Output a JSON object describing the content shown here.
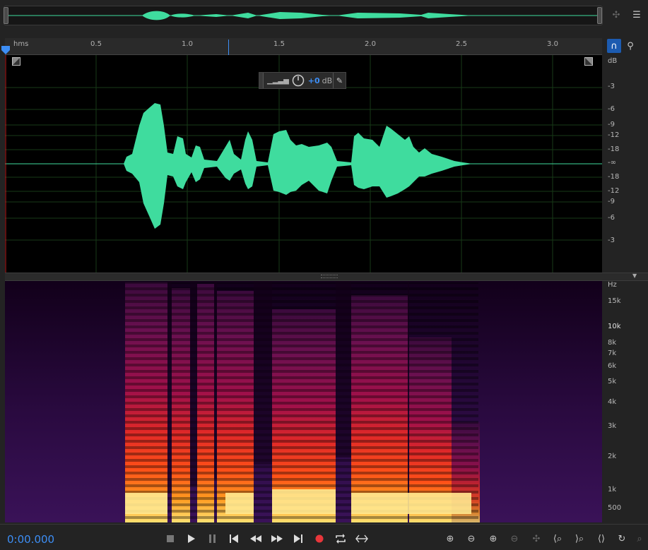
{
  "ruler": {
    "unit_label": "hms",
    "ticks": [
      "0.5",
      "1.0",
      "1.5",
      "2.0",
      "2.5",
      "3.0"
    ]
  },
  "db_scale": {
    "unit": "dB",
    "labels": [
      "-3",
      "-6",
      "-9",
      "-12",
      "-18",
      "-∞",
      "-18",
      "-12",
      "-9",
      "-6",
      "-3"
    ]
  },
  "hz_scale": {
    "unit": "Hz",
    "labels": [
      "15k",
      "10k",
      "8k",
      "7k",
      "6k",
      "5k",
      "4k",
      "3k",
      "2k",
      "1k",
      "500"
    ]
  },
  "hud": {
    "volume_value": "+0",
    "volume_unit": "dB"
  },
  "transport": {
    "timecode": "0:00.000"
  },
  "colors": {
    "waveform": "#3fdc9e",
    "accent": "#3d8ef5",
    "record": "#e8363b"
  },
  "icons": {
    "stop": "stop-icon",
    "play": "play-icon",
    "pause": "pause-icon",
    "previous": "skip-to-start-icon",
    "rewind": "rewind-icon",
    "forward": "fast-forward-icon",
    "next": "skip-to-end-icon",
    "record": "record-icon",
    "loop": "loop-playback-icon",
    "skip_selection": "skip-selection-icon"
  }
}
